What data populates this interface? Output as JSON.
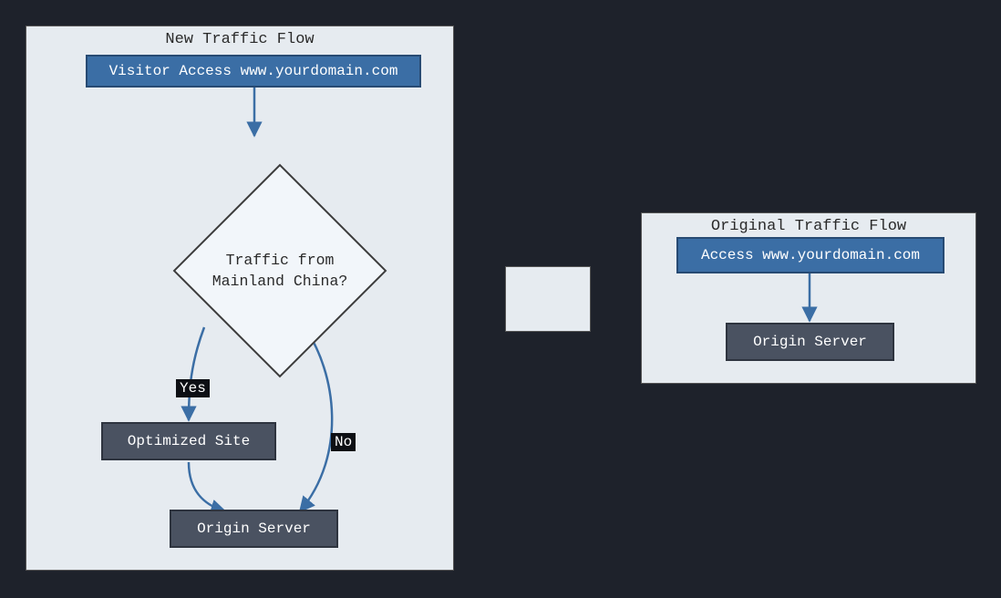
{
  "left": {
    "title": "New Traffic Flow",
    "visitor": "Visitor Access www.yourdomain.com",
    "decision": "Traffic from\nMainland China?",
    "optimized": "Optimized Site",
    "origin": "Origin Server",
    "yes": "Yes",
    "no": "No"
  },
  "right": {
    "title": "Original Traffic Flow",
    "access": "Access www.yourdomain.com",
    "origin": "Origin Server"
  },
  "colors": {
    "panel_bg": "#e6ebf0",
    "blue_fill": "#3b6ea5",
    "blue_border": "#274a73",
    "dark_fill": "#4a5261",
    "dark_border": "#2e343f",
    "bg": "#1e222b"
  }
}
